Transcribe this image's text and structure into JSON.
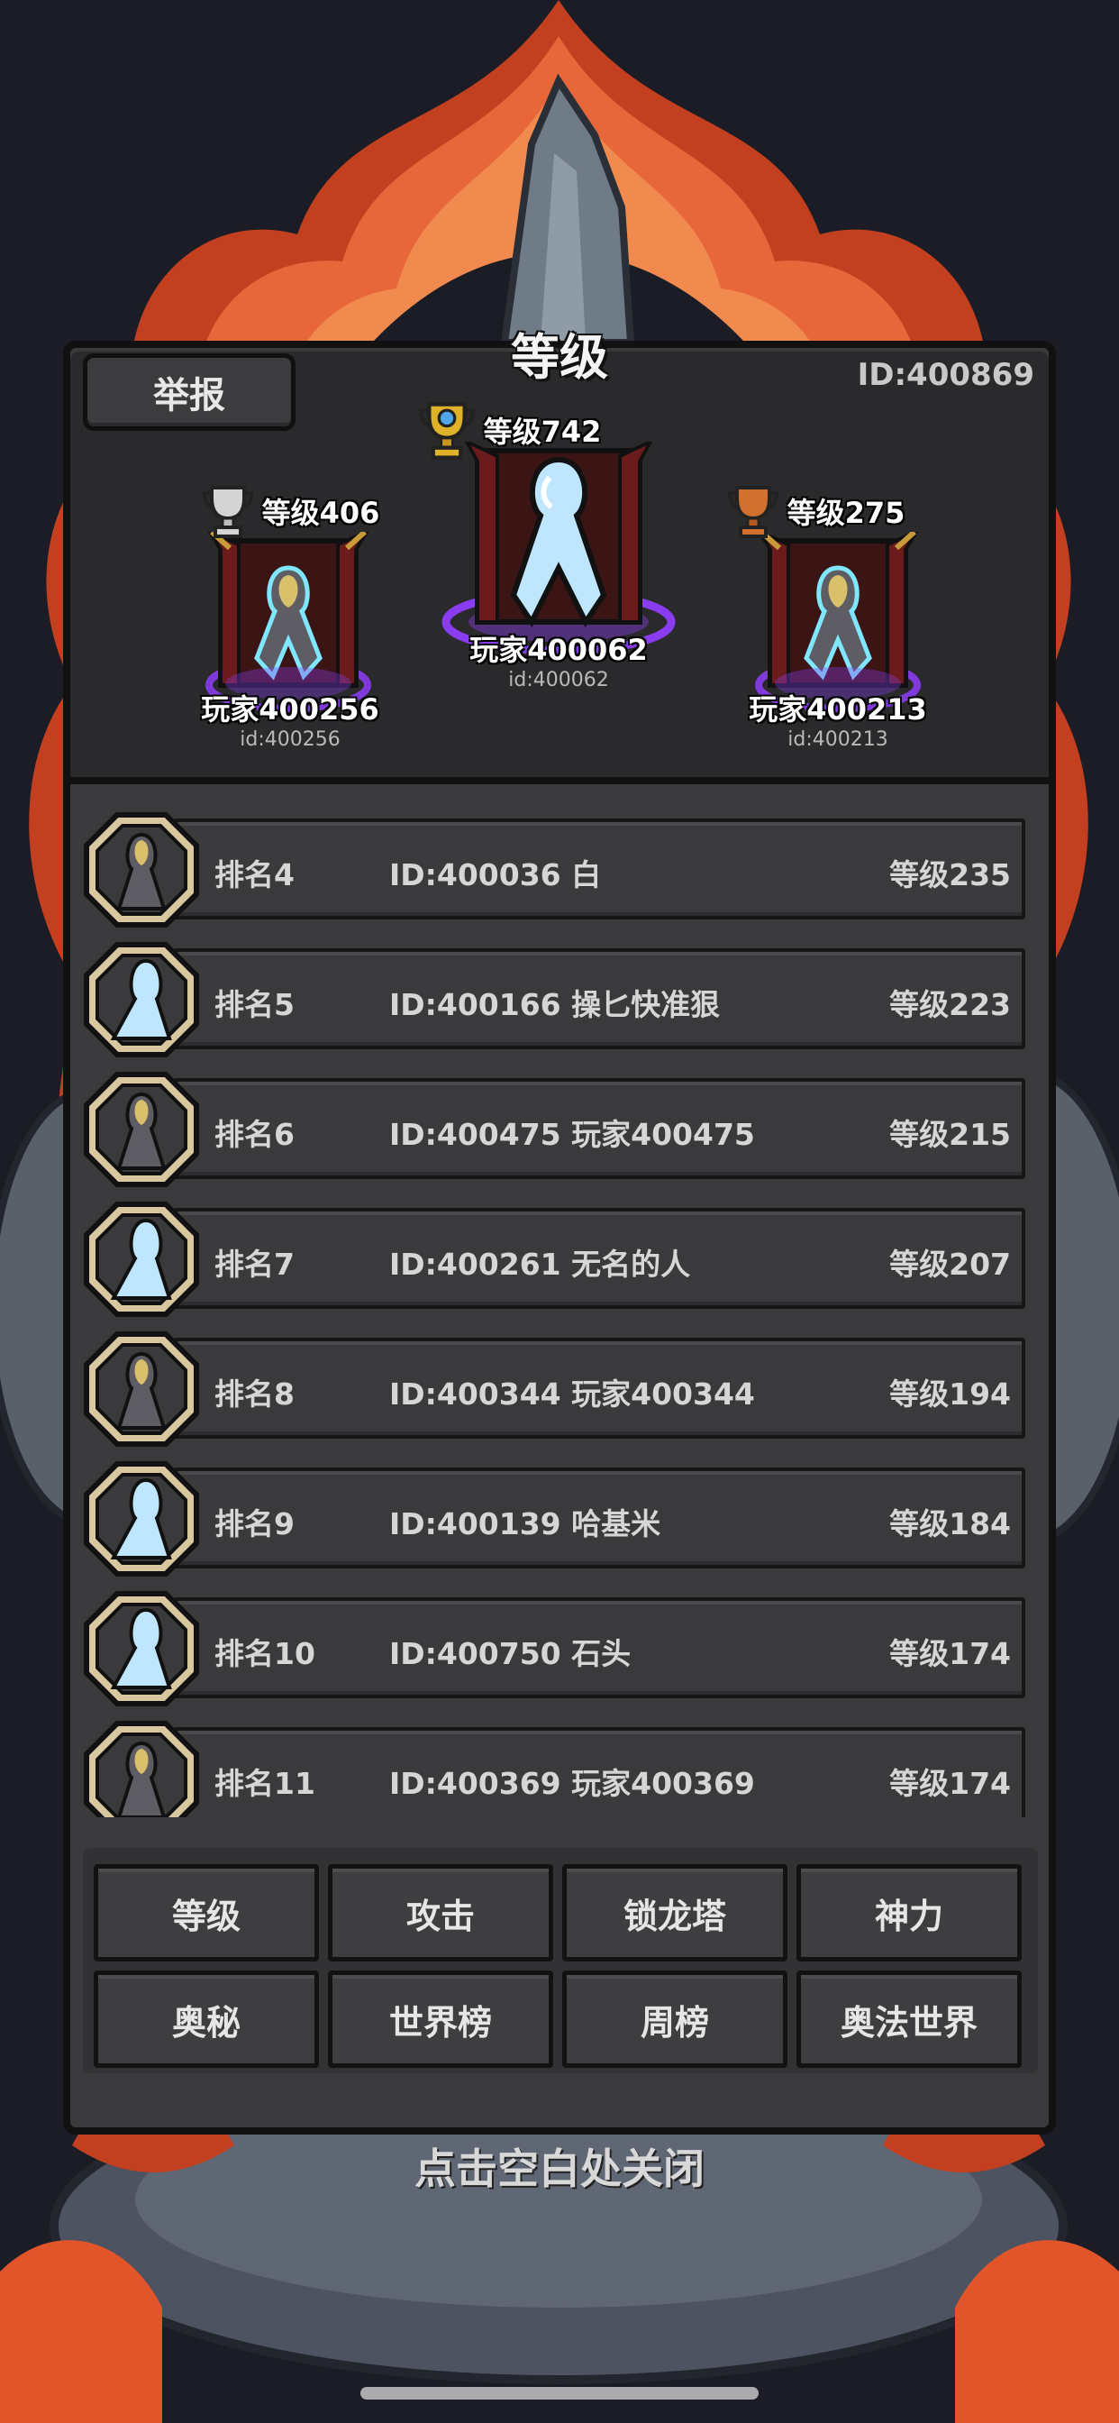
{
  "title": "等级",
  "report_label": "举报",
  "my_id": "ID:400869",
  "podium": [
    {
      "place": "first",
      "level": "等级742",
      "name": "玩家400062",
      "id": "id:400062"
    },
    {
      "place": "second",
      "level": "等级406",
      "name": "玩家400256",
      "id": "id:400256"
    },
    {
      "place": "third",
      "level": "等级275",
      "name": "玩家400213",
      "id": "id:400213"
    }
  ],
  "rows": [
    {
      "rank": "排名4",
      "id_name": "ID:400036 白",
      "level": "等级235",
      "avatar": "dark-knight-avatar"
    },
    {
      "rank": "排名5",
      "id_name": "ID:400166 操匕快准狠",
      "level": "等级223",
      "avatar": "ghost-avatar"
    },
    {
      "rank": "排名6",
      "id_name": "ID:400475 玩家400475",
      "level": "等级215",
      "avatar": "dark-knight-avatar"
    },
    {
      "rank": "排名7",
      "id_name": "ID:400261 无名的人",
      "level": "等级207",
      "avatar": "ghost-avatar"
    },
    {
      "rank": "排名8",
      "id_name": "ID:400344 玩家400344",
      "level": "等级194",
      "avatar": "dark-knight-avatar"
    },
    {
      "rank": "排名9",
      "id_name": "ID:400139 哈基米",
      "level": "等级184",
      "avatar": "ghost-avatar"
    },
    {
      "rank": "排名10",
      "id_name": "ID:400750 石头",
      "level": "等级174",
      "avatar": "ghost-avatar"
    },
    {
      "rank": "排名11",
      "id_name": "ID:400369 玩家400369",
      "level": "等级174",
      "avatar": "dark-knight-avatar"
    }
  ],
  "tabs": [
    "等级",
    "攻击",
    "锁龙塔",
    "神力",
    "奥秘",
    "世界榜",
    "周榜",
    "奥法世界"
  ],
  "close_hint": "点击空白处关闭",
  "colors": {
    "panel": "#3a3a3c",
    "border": "#111111",
    "gold": "#e0b22a",
    "silver": "#c8c8c8",
    "bronze": "#d1702f",
    "portal": "#8a3cf0",
    "ghost": "#bfe6ff",
    "fire": "#e2542a"
  }
}
